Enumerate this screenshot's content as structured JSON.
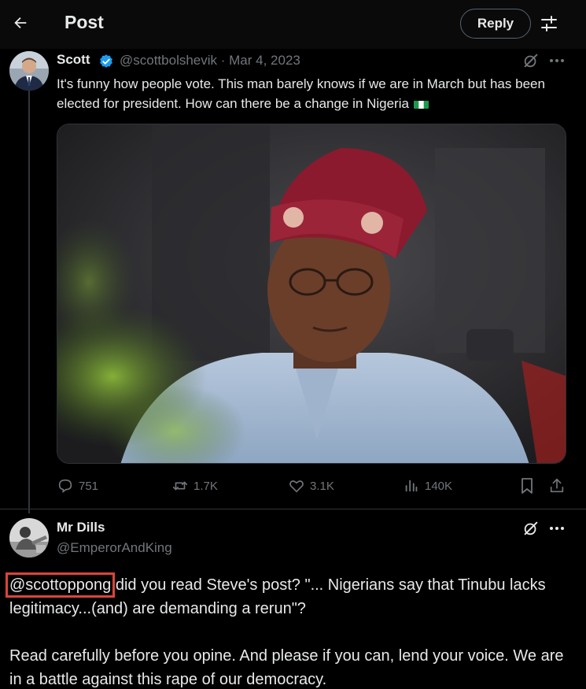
{
  "header": {
    "title": "Post",
    "reply_label": "Reply"
  },
  "tweet": {
    "author_name": "Scott",
    "handle_date": "@scottbolshevik · Mar 4, 2023",
    "text": "It's funny how people vote. This man barely knows if we are in March but has been elected for president. How can there be a change in Nigeria",
    "stats": {
      "replies": "751",
      "reposts": "1.7K",
      "likes": "3.1K",
      "views": "140K"
    }
  },
  "reply": {
    "author_name": "Mr Dills",
    "handle": "@EmperorAndKing",
    "mention": "@scottoppong",
    "text_line1": " did you read Steve's post? \"... Nigerians say that Tinubu lacks legitimacy...(and) are demanding a rerun\"?",
    "text_para2": "Read carefully before you opine. And please if you can, lend your voice. We are in a battle against this rape of our democracy."
  },
  "colors": {
    "background": "#000000",
    "text": "#e7e9ea",
    "muted": "#71767b",
    "verified": "#1d9bf0",
    "highlight_box": "#d9453b"
  },
  "icons": [
    "back-arrow-icon",
    "sliders-icon",
    "verified-badge-icon",
    "grok-icon",
    "more-icon",
    "reply-icon",
    "repost-icon",
    "like-icon",
    "views-icon",
    "bookmark-icon",
    "share-icon"
  ]
}
